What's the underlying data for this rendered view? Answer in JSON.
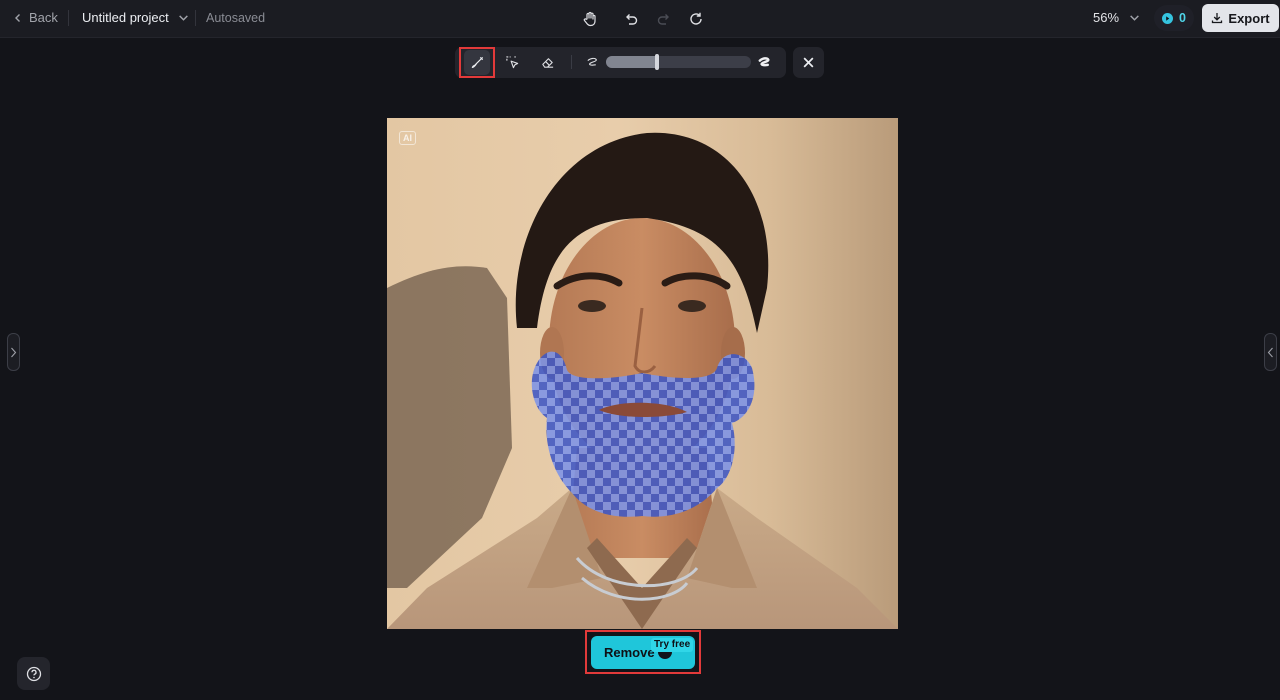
{
  "header": {
    "back_label": "Back",
    "project_title": "Untitled project",
    "save_status": "Autosaved",
    "zoom_level": "56%",
    "credits_count": "0",
    "export_label": "Export"
  },
  "icons": {
    "back": "chevron-left-icon",
    "project_menu": "chevron-down-icon",
    "pan": "hand-icon",
    "undo": "undo-icon",
    "redo": "redo-icon",
    "reset": "refresh-icon",
    "zoom_menu": "chevron-down-icon",
    "credit": "credit-coin-icon",
    "export": "download-icon",
    "brush": "brush-icon",
    "smart_select": "select-cursor-icon",
    "eraser": "eraser-icon",
    "brush_small": "small-brush-icon",
    "brush_large": "large-brush-icon",
    "close": "close-icon",
    "help": "help-icon"
  },
  "brush_toolbar": {
    "active_tool": "brush",
    "brush_size_fraction": 0.35
  },
  "canvas": {
    "ai_badge": "AI"
  },
  "actions": {
    "remove_label": "Remove",
    "try_free_badge": "Try free"
  },
  "colors": {
    "accent": "#1fc6da",
    "background": "#131419",
    "highlight": "#e23a3a",
    "mask": "#4a66e0"
  }
}
